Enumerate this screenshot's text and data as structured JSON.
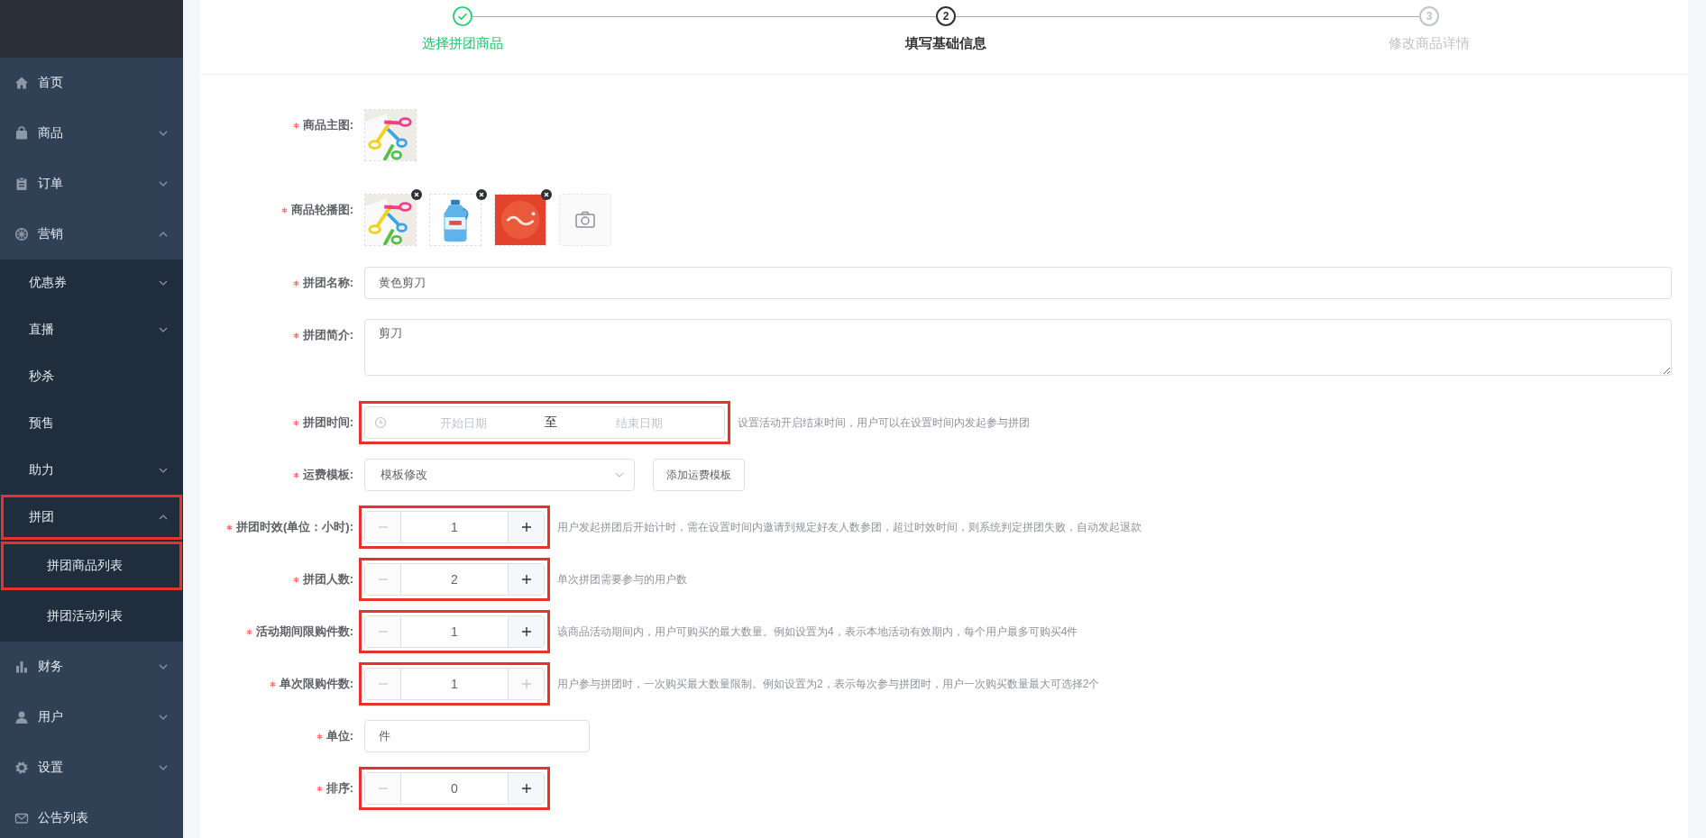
{
  "sidebar": {
    "items": [
      {
        "label": "首页",
        "kind": "link",
        "highlighted": false
      },
      {
        "label": "商品",
        "kind": "submenu",
        "expanded": false,
        "highlighted": false
      },
      {
        "label": "订单",
        "kind": "submenu",
        "expanded": false,
        "highlighted": false
      },
      {
        "label": "营销",
        "kind": "submenu",
        "expanded": true,
        "highlighted": false,
        "children": [
          {
            "label": "优惠券",
            "kind": "submenu",
            "expanded": false,
            "highlighted": false
          },
          {
            "label": "直播",
            "kind": "submenu",
            "expanded": false,
            "highlighted": false
          },
          {
            "label": "秒杀",
            "kind": "link",
            "highlighted": false
          },
          {
            "label": "预售",
            "kind": "link",
            "highlighted": false
          },
          {
            "label": "助力",
            "kind": "submenu",
            "expanded": false,
            "highlighted": false
          },
          {
            "label": "拼团",
            "kind": "submenu",
            "expanded": true,
            "highlighted": true,
            "children": [
              {
                "label": "拼团商品列表",
                "kind": "link",
                "highlighted": true
              },
              {
                "label": "拼团活动列表",
                "kind": "link",
                "highlighted": false
              }
            ]
          }
        ]
      },
      {
        "label": "财务",
        "kind": "submenu",
        "expanded": false,
        "highlighted": false
      },
      {
        "label": "用户",
        "kind": "submenu",
        "expanded": false,
        "highlighted": false
      },
      {
        "label": "设置",
        "kind": "submenu",
        "expanded": false,
        "highlighted": false
      },
      {
        "label": "公告列表",
        "kind": "link",
        "highlighted": false
      }
    ]
  },
  "steps": [
    {
      "label": "选择拼团商品",
      "done": true,
      "current": false
    },
    {
      "label": "填写基础信息",
      "done": false,
      "current": true,
      "number": "2"
    },
    {
      "label": "修改商品详情",
      "done": false,
      "current": false,
      "number": "3"
    }
  ],
  "form": {
    "fields": [
      {
        "label": "商品主图:",
        "required": true,
        "highlighted": false,
        "images": [
          {
            "removable": false
          }
        ]
      },
      {
        "kind": "gallery",
        "label": "商品轮播图:",
        "required": true,
        "highlighted": false,
        "images": [
          {
            "removable": true
          },
          {
            "removable": true
          },
          {
            "removable": true
          }
        ],
        "upload": true
      },
      {
        "kind": "text",
        "label": "拼团名称:",
        "required": true,
        "highlighted": false,
        "value": "黄色剪刀"
      },
      {
        "kind": "textarea",
        "label": "拼团简介:",
        "required": true,
        "highlighted": false,
        "value": "剪刀"
      },
      {
        "kind": "daterange",
        "label": "拼团时间:",
        "required": true,
        "highlighted": true,
        "start_placeholder": "开始日期",
        "separator": "至",
        "end_placeholder": "结束日期",
        "hint": "设置活动开启结束时间，用户可以在设置时间内发起参与拼团"
      },
      {
        "kind": "select",
        "label": "运费模板:",
        "required": true,
        "highlighted": false,
        "value": "模板修改",
        "button": "添加运费模板"
      },
      {
        "kind": "number",
        "label": "拼团时效(单位：小时):",
        "required": true,
        "highlighted": true,
        "value": "1",
        "minus_disabled": true,
        "plus_disabled": false,
        "hint": "用户发起拼团后开始计时，需在设置时间内邀请到规定好友人数参团，超过时效时间，则系统判定拼团失败，自动发起退款"
      },
      {
        "kind": "number",
        "label": "拼团人数:",
        "required": true,
        "highlighted": true,
        "value": "2",
        "minus_disabled": true,
        "plus_disabled": false,
        "hint": "单次拼团需要参与的用户数"
      },
      {
        "kind": "number",
        "label": "活动期间限购件数:",
        "required": true,
        "highlighted": true,
        "value": "1",
        "minus_disabled": true,
        "plus_disabled": false,
        "hint": "该商品活动期间内，用户可购买的最大数量。例如设置为4，表示本地活动有效期内，每个用户最多可购买4件"
      },
      {
        "kind": "number",
        "label": "单次限购件数:",
        "required": true,
        "highlighted": true,
        "value": "1",
        "minus_disabled": true,
        "plus_disabled": true,
        "hint": "用户参与拼团时，一次购买最大数量限制。例如设置为2，表示每次参与拼团时，用户一次购买数量最大可选择2个"
      },
      {
        "kind": "short-text",
        "label": "单位:",
        "required": true,
        "highlighted": false,
        "value": "件"
      },
      {
        "kind": "number",
        "label": "排序:",
        "required": true,
        "highlighted": true,
        "value": "0",
        "minus_disabled": true,
        "plus_disabled": false
      }
    ]
  }
}
